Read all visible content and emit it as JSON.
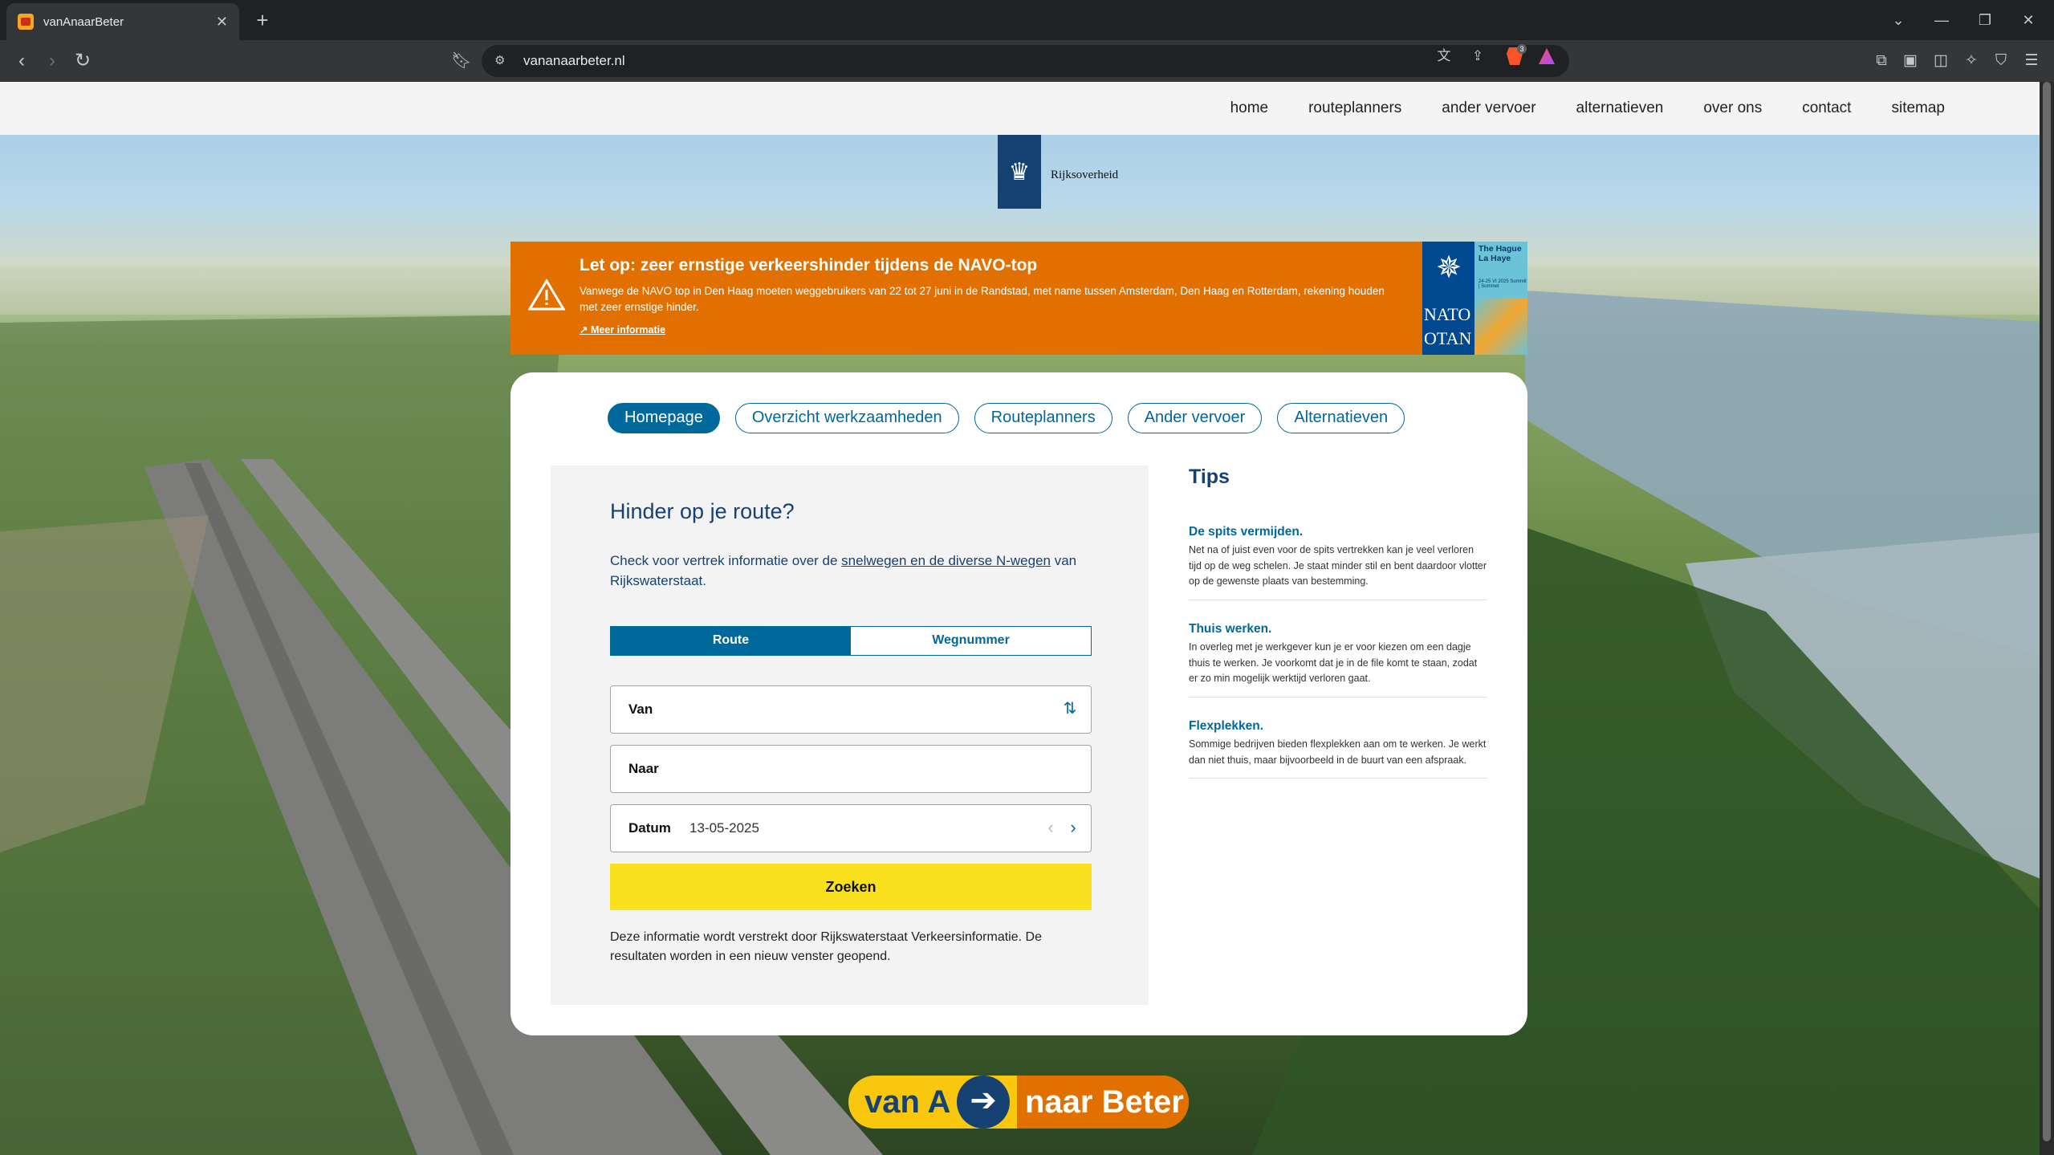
{
  "browser": {
    "tab_title": "vanAnaarBeter",
    "tab_close": "✕",
    "new_tab": "+",
    "url": "vananaarbeter.nl",
    "brave_shield_count": "3",
    "window_controls": [
      "⌄",
      "—",
      "❐",
      "✕"
    ]
  },
  "site_nav": {
    "items": [
      "home",
      "routeplanners",
      "ander vervoer",
      "alternatieven",
      "over ons",
      "contact",
      "sitemap"
    ]
  },
  "logo": {
    "name": "Rijksoverheid"
  },
  "alert": {
    "title": "Let op: zeer ernstige verkeershinder tijdens de NAVO-top",
    "body": "Vanwege de NAVO top in Den Haag moeten weggebruikers van 22 tot 27 juni in de Randstad, met name tussen Amsterdam, Den Haag en Rotterdam, rekening houden met zeer ernstige hinder.",
    "link": "↗ Meer informatie",
    "badge_city": "The Hague La Haye",
    "badge_dates": "24-25 VI 2025 Summit | Sommet",
    "badge_nato": "NATO",
    "badge_otan": "OTAN"
  },
  "tabs": [
    {
      "label": "Homepage",
      "active": true
    },
    {
      "label": "Overzicht werkzaamheden",
      "active": false
    },
    {
      "label": "Routeplanners",
      "active": false
    },
    {
      "label": "Ander vervoer",
      "active": false
    },
    {
      "label": "Alternatieven",
      "active": false
    }
  ],
  "form": {
    "title": "Hinder op je route?",
    "intro_prefix": "Check voor vertrek informatie over de ",
    "intro_link": "snelwegen en de diverse N-wegen",
    "intro_suffix": " van Rijkswaterstaat.",
    "toggle": {
      "route": "Route",
      "road_number": "Wegnummer",
      "selected": "Route"
    },
    "from_label": "Van",
    "to_label": "Naar",
    "date_label": "Datum",
    "date_value": "13-05-2025",
    "search_button": "Zoeken",
    "disclaimer": "Deze informatie wordt verstrekt door Rijkswaterstaat Verkeersinformatie. De resultaten worden in een nieuw venster geopend."
  },
  "tips": {
    "title": "Tips",
    "items": [
      {
        "title": "De spits vermijden.",
        "text": "Net na of juist even voor de spits vertrekken kan je veel verloren tijd op de weg schelen. Je staat minder stil en bent daardoor vlotter op de gewenste plaats van bestemming."
      },
      {
        "title": "Thuis werken.",
        "text": "In overleg met je werkgever kun je er voor kiezen om een dagje thuis te werken. Je voorkomt dat je in de file komt te staan, zodat er zo min mogelijk werktijd verloren gaat."
      },
      {
        "title": "Flexplekken.",
        "text": "Sommige bedrijven bieden flexplekken aan om te werken. Je werkt dan niet thuis, maar bijvoorbeeld in de buurt van een afspraak."
      }
    ]
  },
  "brand": {
    "part_a": "van A",
    "arrow": "➔",
    "part_b": "naar Beter"
  },
  "colors": {
    "rijks_blue": "#154273",
    "link_blue": "#01689b",
    "alert_orange": "#e17000",
    "search_yellow": "#f9e11e"
  }
}
